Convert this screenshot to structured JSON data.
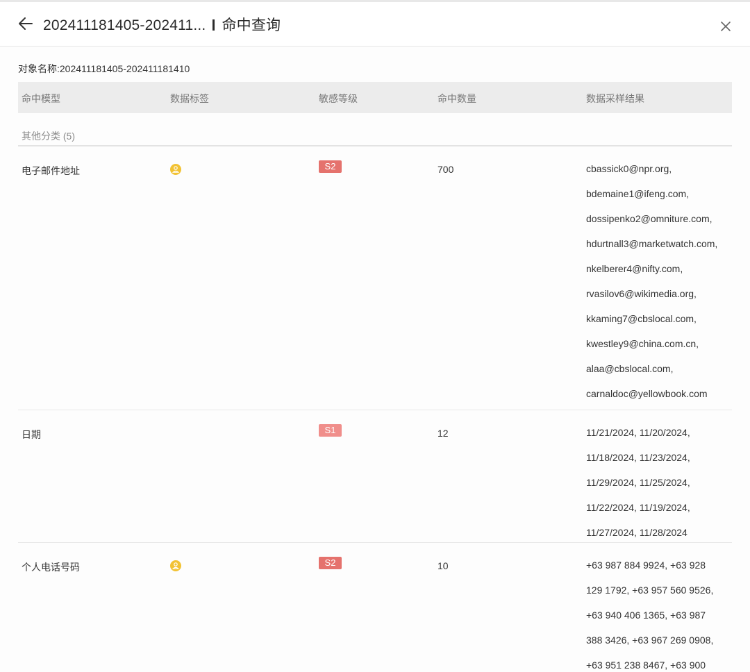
{
  "header": {
    "title": "202411181405-202411...",
    "subtitle": "命中查询"
  },
  "object_name": "对象名称:202411181405-202411181410",
  "table": {
    "columns": [
      "命中模型",
      "数据标签",
      "敏感等级",
      "命中数量",
      "数据采样结果"
    ],
    "group_label": "其他分类 (5)",
    "rows": [
      {
        "model": "电子邮件地址",
        "has_tag": true,
        "level": "S2",
        "level_color": "#e5726d",
        "count": "700",
        "samples": [
          "cbassick0@npr.org,",
          "bdemaine1@ifeng.com,",
          "dossipenko2@omniture.com,",
          "hdurtnall3@marketwatch.com,",
          "nkelberer4@nifty.com,",
          "rvasilov6@wikimedia.org,",
          "kkaming7@cbslocal.com,",
          "kwestley9@china.com.cn,",
          "alaa@cbslocal.com,",
          "carnaldoc@yellowbook.com"
        ]
      },
      {
        "model": "日期",
        "has_tag": false,
        "level": "S1",
        "level_color": "#f08e8b",
        "count": "12",
        "samples": [
          "11/21/2024, 11/20/2024,",
          "11/18/2024, 11/23/2024,",
          "11/29/2024, 11/25/2024,",
          "11/22/2024, 11/19/2024,",
          "11/27/2024, 11/28/2024"
        ]
      },
      {
        "model": "个人电话号码",
        "has_tag": true,
        "level": "S2",
        "level_color": "#e5726d",
        "count": "10",
        "samples": [
          "+63 987 884 9924, +63 928",
          "129 1792, +63 957 560 9526,",
          "+63 940 406 1365, +63 987",
          "388 3426, +63 967 269 0908,",
          "+63 951 238 8467, +63 900"
        ]
      }
    ]
  },
  "colors": {
    "tag_icon": "#f2c233",
    "header_bg": "#ececec"
  }
}
